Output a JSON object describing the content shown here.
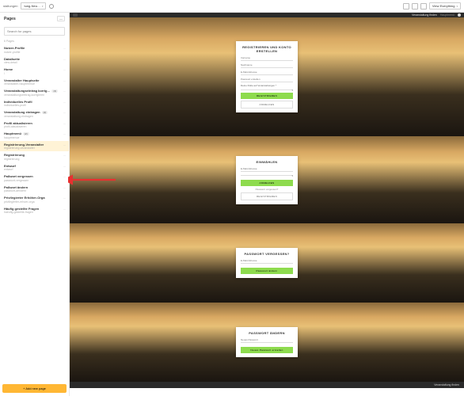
{
  "topbar": {
    "breadcrumb1": "staltungen",
    "breadcrumb2": "tung-Neu…",
    "viewMode": "View Everything"
  },
  "sidebar": {
    "heading": "Pages",
    "searchPlaceholder": "Search for pages",
    "count": "6 Pages",
    "items": [
      {
        "title": "Nutzer-Profile",
        "sub": "nutzer-profile"
      },
      {
        "title": "Datailseite",
        "sub": "view-detail"
      },
      {
        "title": "Home",
        "sub": "/"
      },
      {
        "title": "Veranstalter Hauptseite",
        "sub": "veranstalter-hauptmenue"
      },
      {
        "title": "Veranstaltungseintrag korrig…",
        "sub": "veranstaltungseintrag-korrigieren",
        "badge": "(2)"
      },
      {
        "title": "Individuelles Profil",
        "sub": "individuelles-profil"
      },
      {
        "title": "Veranstaltung eintragen",
        "sub": "veranstaltung-eintragen",
        "badge": "(2)"
      },
      {
        "title": "Profil aktualisieren",
        "sub": "profil-aktualisieren"
      },
      {
        "title": "Hauptmenü",
        "sub": "hauptmenue",
        "badge": "(2)"
      },
      {
        "title": "Registrierung-Veranstalter",
        "sub": "registrierung-veranstalter",
        "selected": true
      },
      {
        "title": "Registrierung",
        "sub": "registrierung"
      },
      {
        "title": "Entwurf",
        "sub": "entwurf"
      },
      {
        "title": "Paßwort vergessen",
        "sub": "passwort-vergessen"
      },
      {
        "title": "Paßwort ändern",
        "sub": "passwort-aendern"
      },
      {
        "title": "Privilegierter Erhöher-Orga",
        "sub": "privilegierter-erhoer-orga"
      },
      {
        "title": "Häufig gestellte Fragen",
        "sub": "haeufig-gestellte-fragen"
      }
    ],
    "addBtn": "+ Add new page"
  },
  "previewHeader": {
    "link1": "Veranstaltung finden",
    "link2": "Hauptmenü"
  },
  "card1": {
    "title": "REGISTRIEREN UND KONTO ERSTELLEN",
    "f1": "Vorname",
    "f2": "Nachname",
    "f3": "E-Mail-Adresse",
    "f4": "Passwort erstellen",
    "roleQ": "Deine Rolle auf Veranstaltungen *",
    "btn": "REGISTRIEREN",
    "alt": "ANMELDEN"
  },
  "card2": {
    "title": "EINWÄHLEN",
    "f1": "E-Mail-Adresse",
    "f2": "Passwort",
    "btn": "ANMELDEN",
    "link": "Passwort vergessen?",
    "alt": "REGISTRIEREN"
  },
  "card3": {
    "title": "PASSWORT VERGESSEN?",
    "f1": "E-Mail-Adresse",
    "btn": "Passwort ändern"
  },
  "card4": {
    "title": "PASSWORT ÄNDERN",
    "f1": "Neues Passwort",
    "btn": "Neues Passwort erstellen"
  },
  "footer": {
    "text": "Veranstaltung finden"
  }
}
